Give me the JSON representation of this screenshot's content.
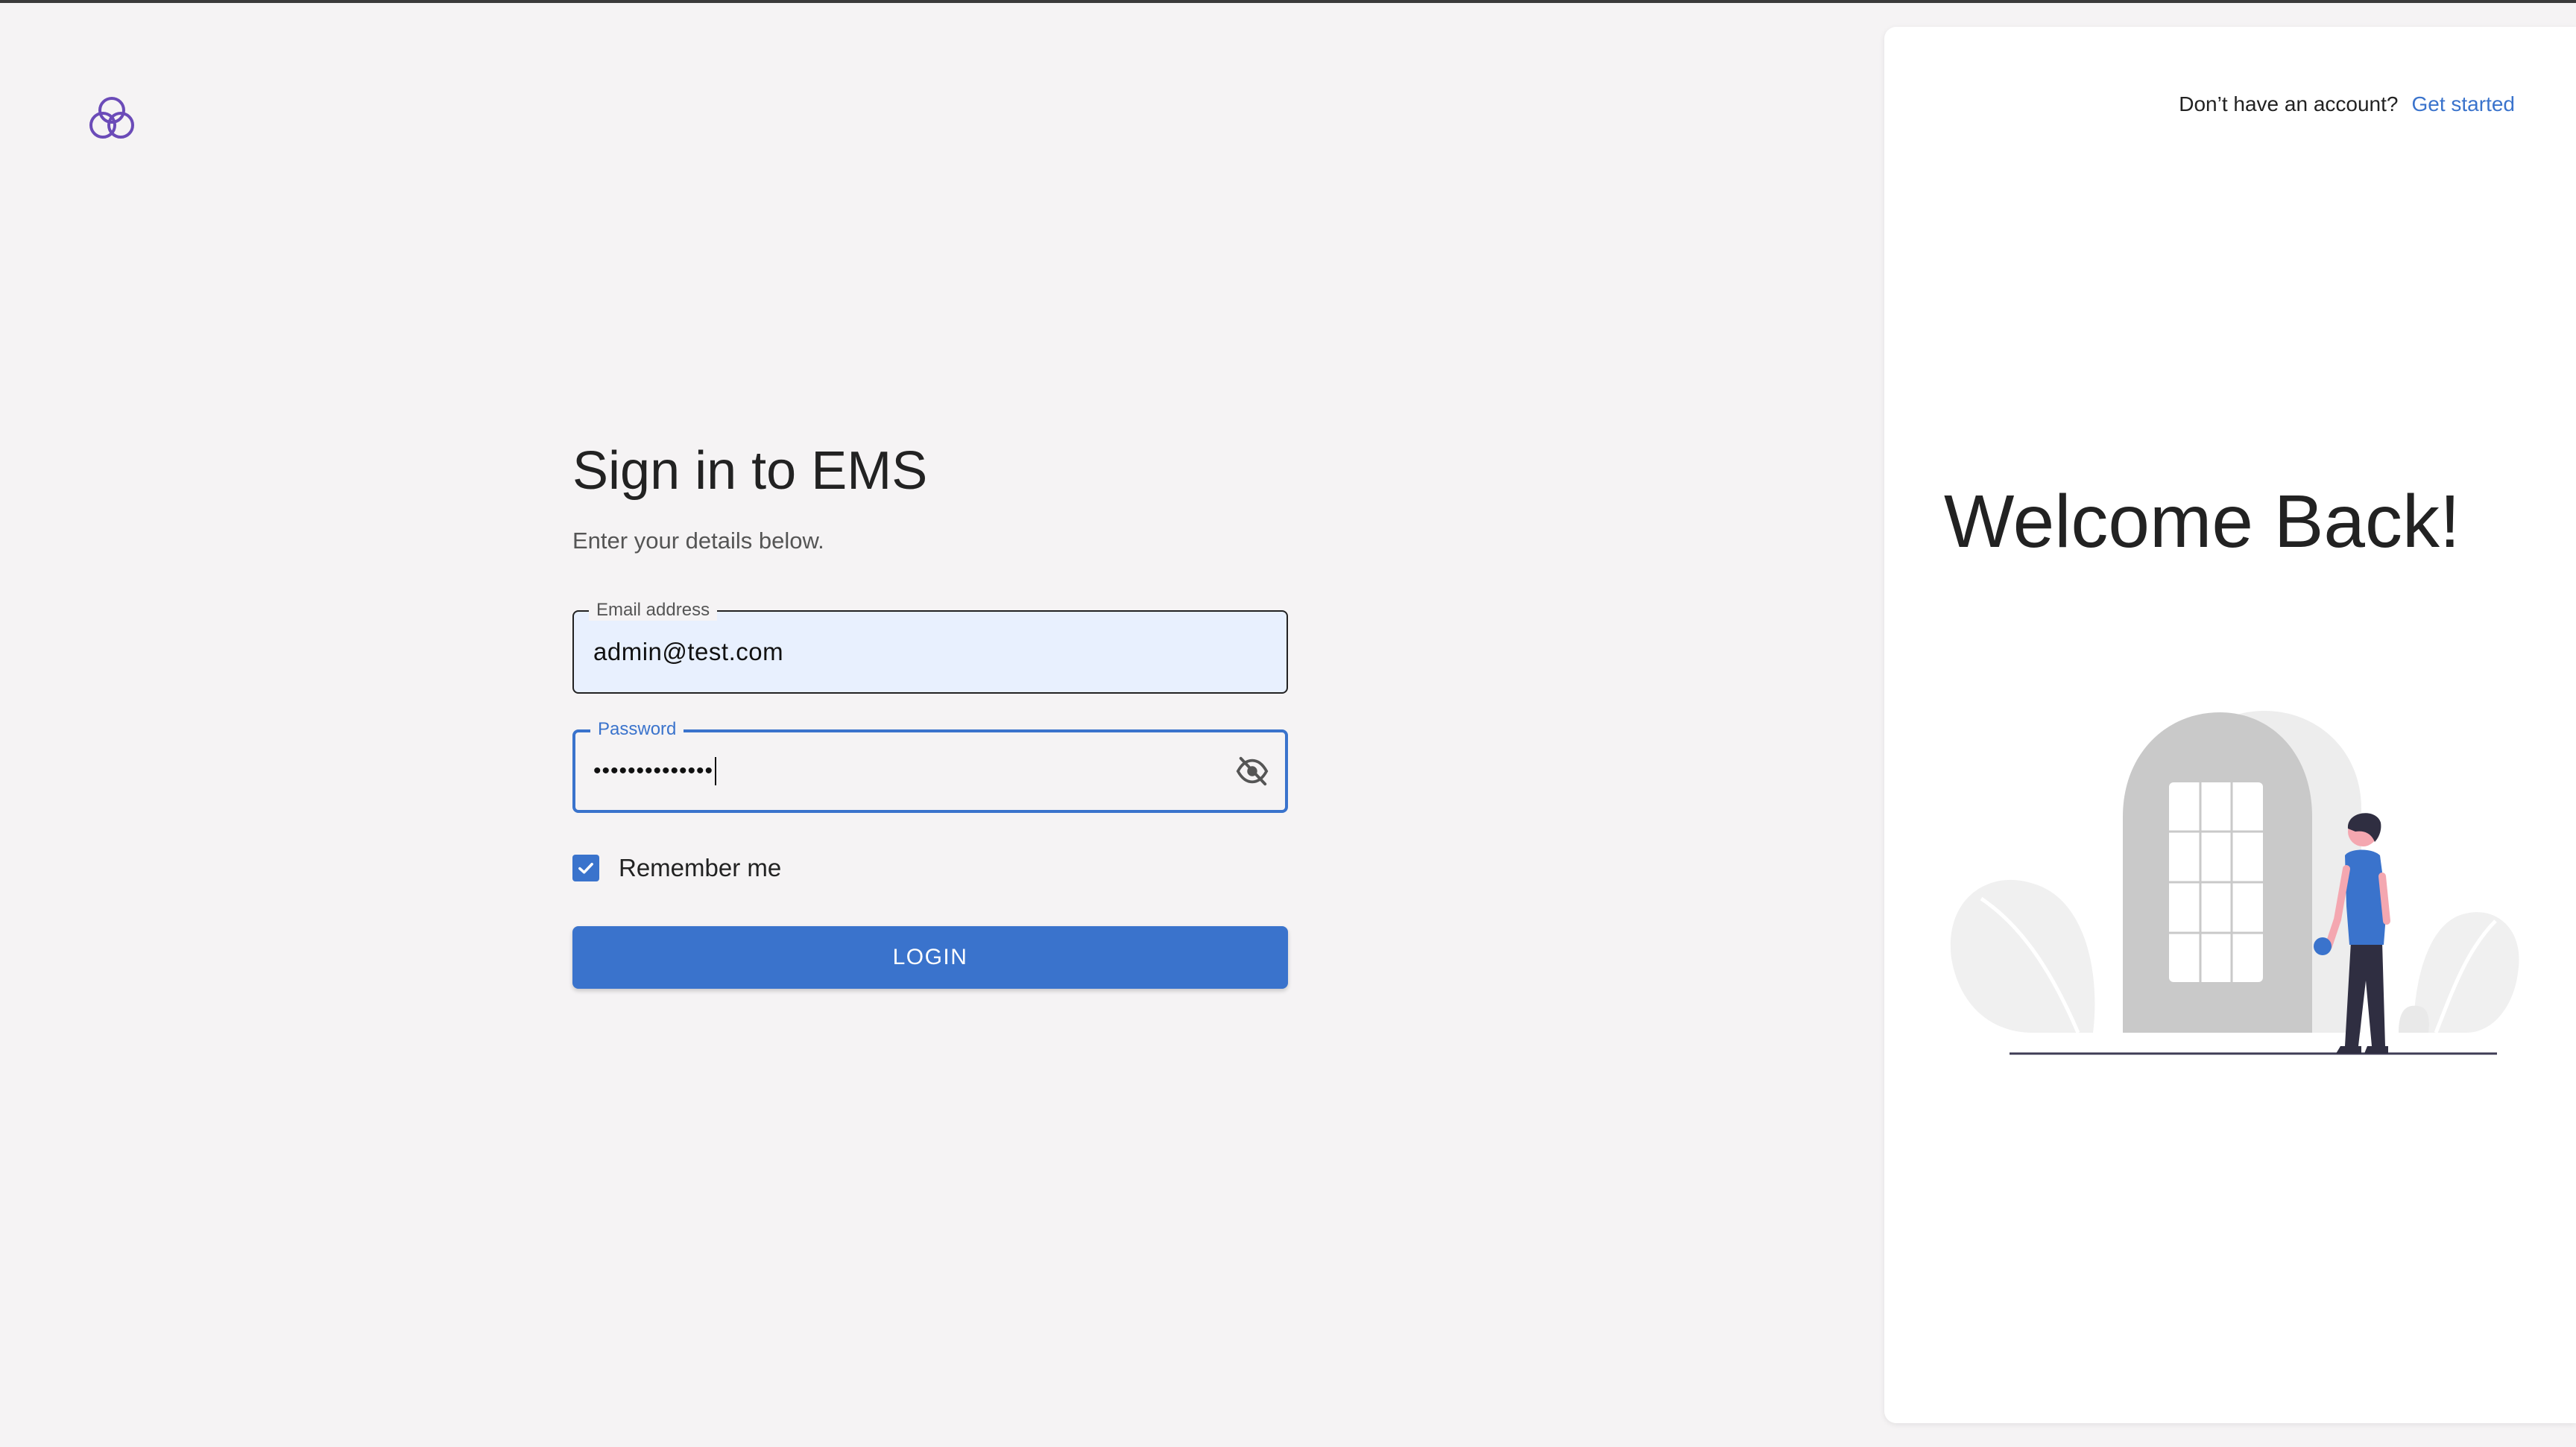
{
  "app": {
    "name": "EMS"
  },
  "login": {
    "title": "Sign in to EMS",
    "subtitle": "Enter your details below.",
    "email": {
      "label": "Email address",
      "value": "admin@test.com"
    },
    "password": {
      "label": "Password",
      "masked_value": "••••••••••••••"
    },
    "remember_me": {
      "label": "Remember me",
      "checked": true
    },
    "login_button": "LOGIN"
  },
  "side_panel": {
    "signup_prompt": "Don’t have an account?",
    "signup_link": "Get started",
    "welcome": "Welcome Back!"
  },
  "icons": {
    "logo": "triquetra-logo-icon",
    "password_toggle": "eye-off-icon",
    "checkbox": "check-icon"
  },
  "colors": {
    "accent": "#3a73cc",
    "logo": "#6b4bb8",
    "background": "#f5f3f4",
    "email_fill": "#e8f0fe"
  }
}
